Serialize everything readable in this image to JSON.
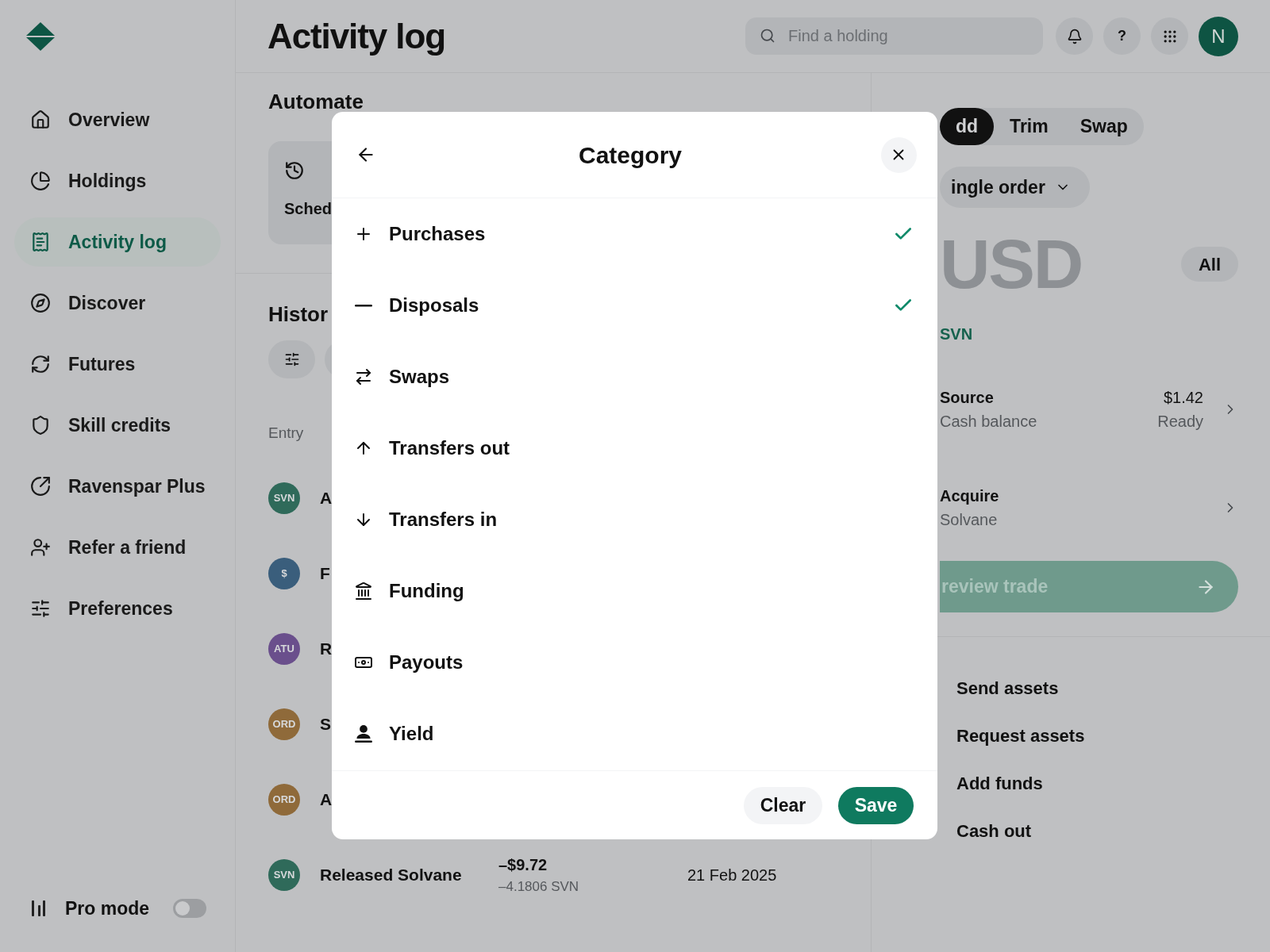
{
  "sidebar": {
    "items": [
      {
        "label": "Overview",
        "selected": false
      },
      {
        "label": "Holdings",
        "selected": false
      },
      {
        "label": "Activity log",
        "selected": true
      },
      {
        "label": "Discover",
        "selected": false
      },
      {
        "label": "Futures",
        "selected": false
      },
      {
        "label": "Skill credits",
        "selected": false
      },
      {
        "label": "Ravenspar Plus",
        "selected": false
      },
      {
        "label": "Refer a friend",
        "selected": false
      },
      {
        "label": "Preferences",
        "selected": false
      }
    ],
    "pro_mode": {
      "label": "Pro mode",
      "on": false
    }
  },
  "header": {
    "title": "Activity log",
    "search": {
      "placeholder": "Find a holding"
    },
    "help": "?",
    "avatar": "N"
  },
  "automate": {
    "title": "Automate",
    "card_label": "Sched"
  },
  "history": {
    "title": "Histor",
    "column": "Entry",
    "rows": [
      {
        "badge": "SVN",
        "color": "#2f6a5a",
        "title": "A"
      },
      {
        "badge": "$",
        "color": "#3a5e7c",
        "title": "F"
      },
      {
        "badge": "ATU",
        "color": "#6a4f8c",
        "title": "R"
      },
      {
        "badge": "ORD",
        "color": "#8f6a3a",
        "title": "S"
      },
      {
        "badge": "ORD",
        "color": "#8f6a3a",
        "title": "A"
      },
      {
        "badge": "SVN",
        "color": "#2f6a5a",
        "title": "Released Solvane",
        "amount": "–$9.72",
        "units": "–4.1806 SVN",
        "date": "21 Feb 2025"
      }
    ]
  },
  "trade": {
    "tabs": [
      {
        "label": "dd",
        "selected": true
      },
      {
        "label": "Trim",
        "selected": false
      },
      {
        "label": "Swap",
        "selected": false
      }
    ],
    "order_type": "ingle order",
    "amount_unit": "USD",
    "all_button": "All",
    "conversion": "SVN",
    "source": {
      "title": "Source",
      "subtitle": "Cash balance",
      "value": "$1.42",
      "status": "Ready"
    },
    "acquire": {
      "title": "Acquire",
      "subtitle": "Solvane"
    },
    "preview": "review trade"
  },
  "actions": [
    "Send assets",
    "Request assets",
    "Add funds",
    "Cash out"
  ],
  "modal": {
    "title": "Category",
    "items": [
      {
        "label": "Purchases",
        "checked": true
      },
      {
        "label": "Disposals",
        "checked": true
      },
      {
        "label": "Swaps",
        "checked": false
      },
      {
        "label": "Transfers out",
        "checked": false
      },
      {
        "label": "Transfers in",
        "checked": false
      },
      {
        "label": "Funding",
        "checked": false
      },
      {
        "label": "Payouts",
        "checked": false
      },
      {
        "label": "Yield",
        "checked": false
      }
    ],
    "clear": "Clear",
    "save": "Save"
  }
}
